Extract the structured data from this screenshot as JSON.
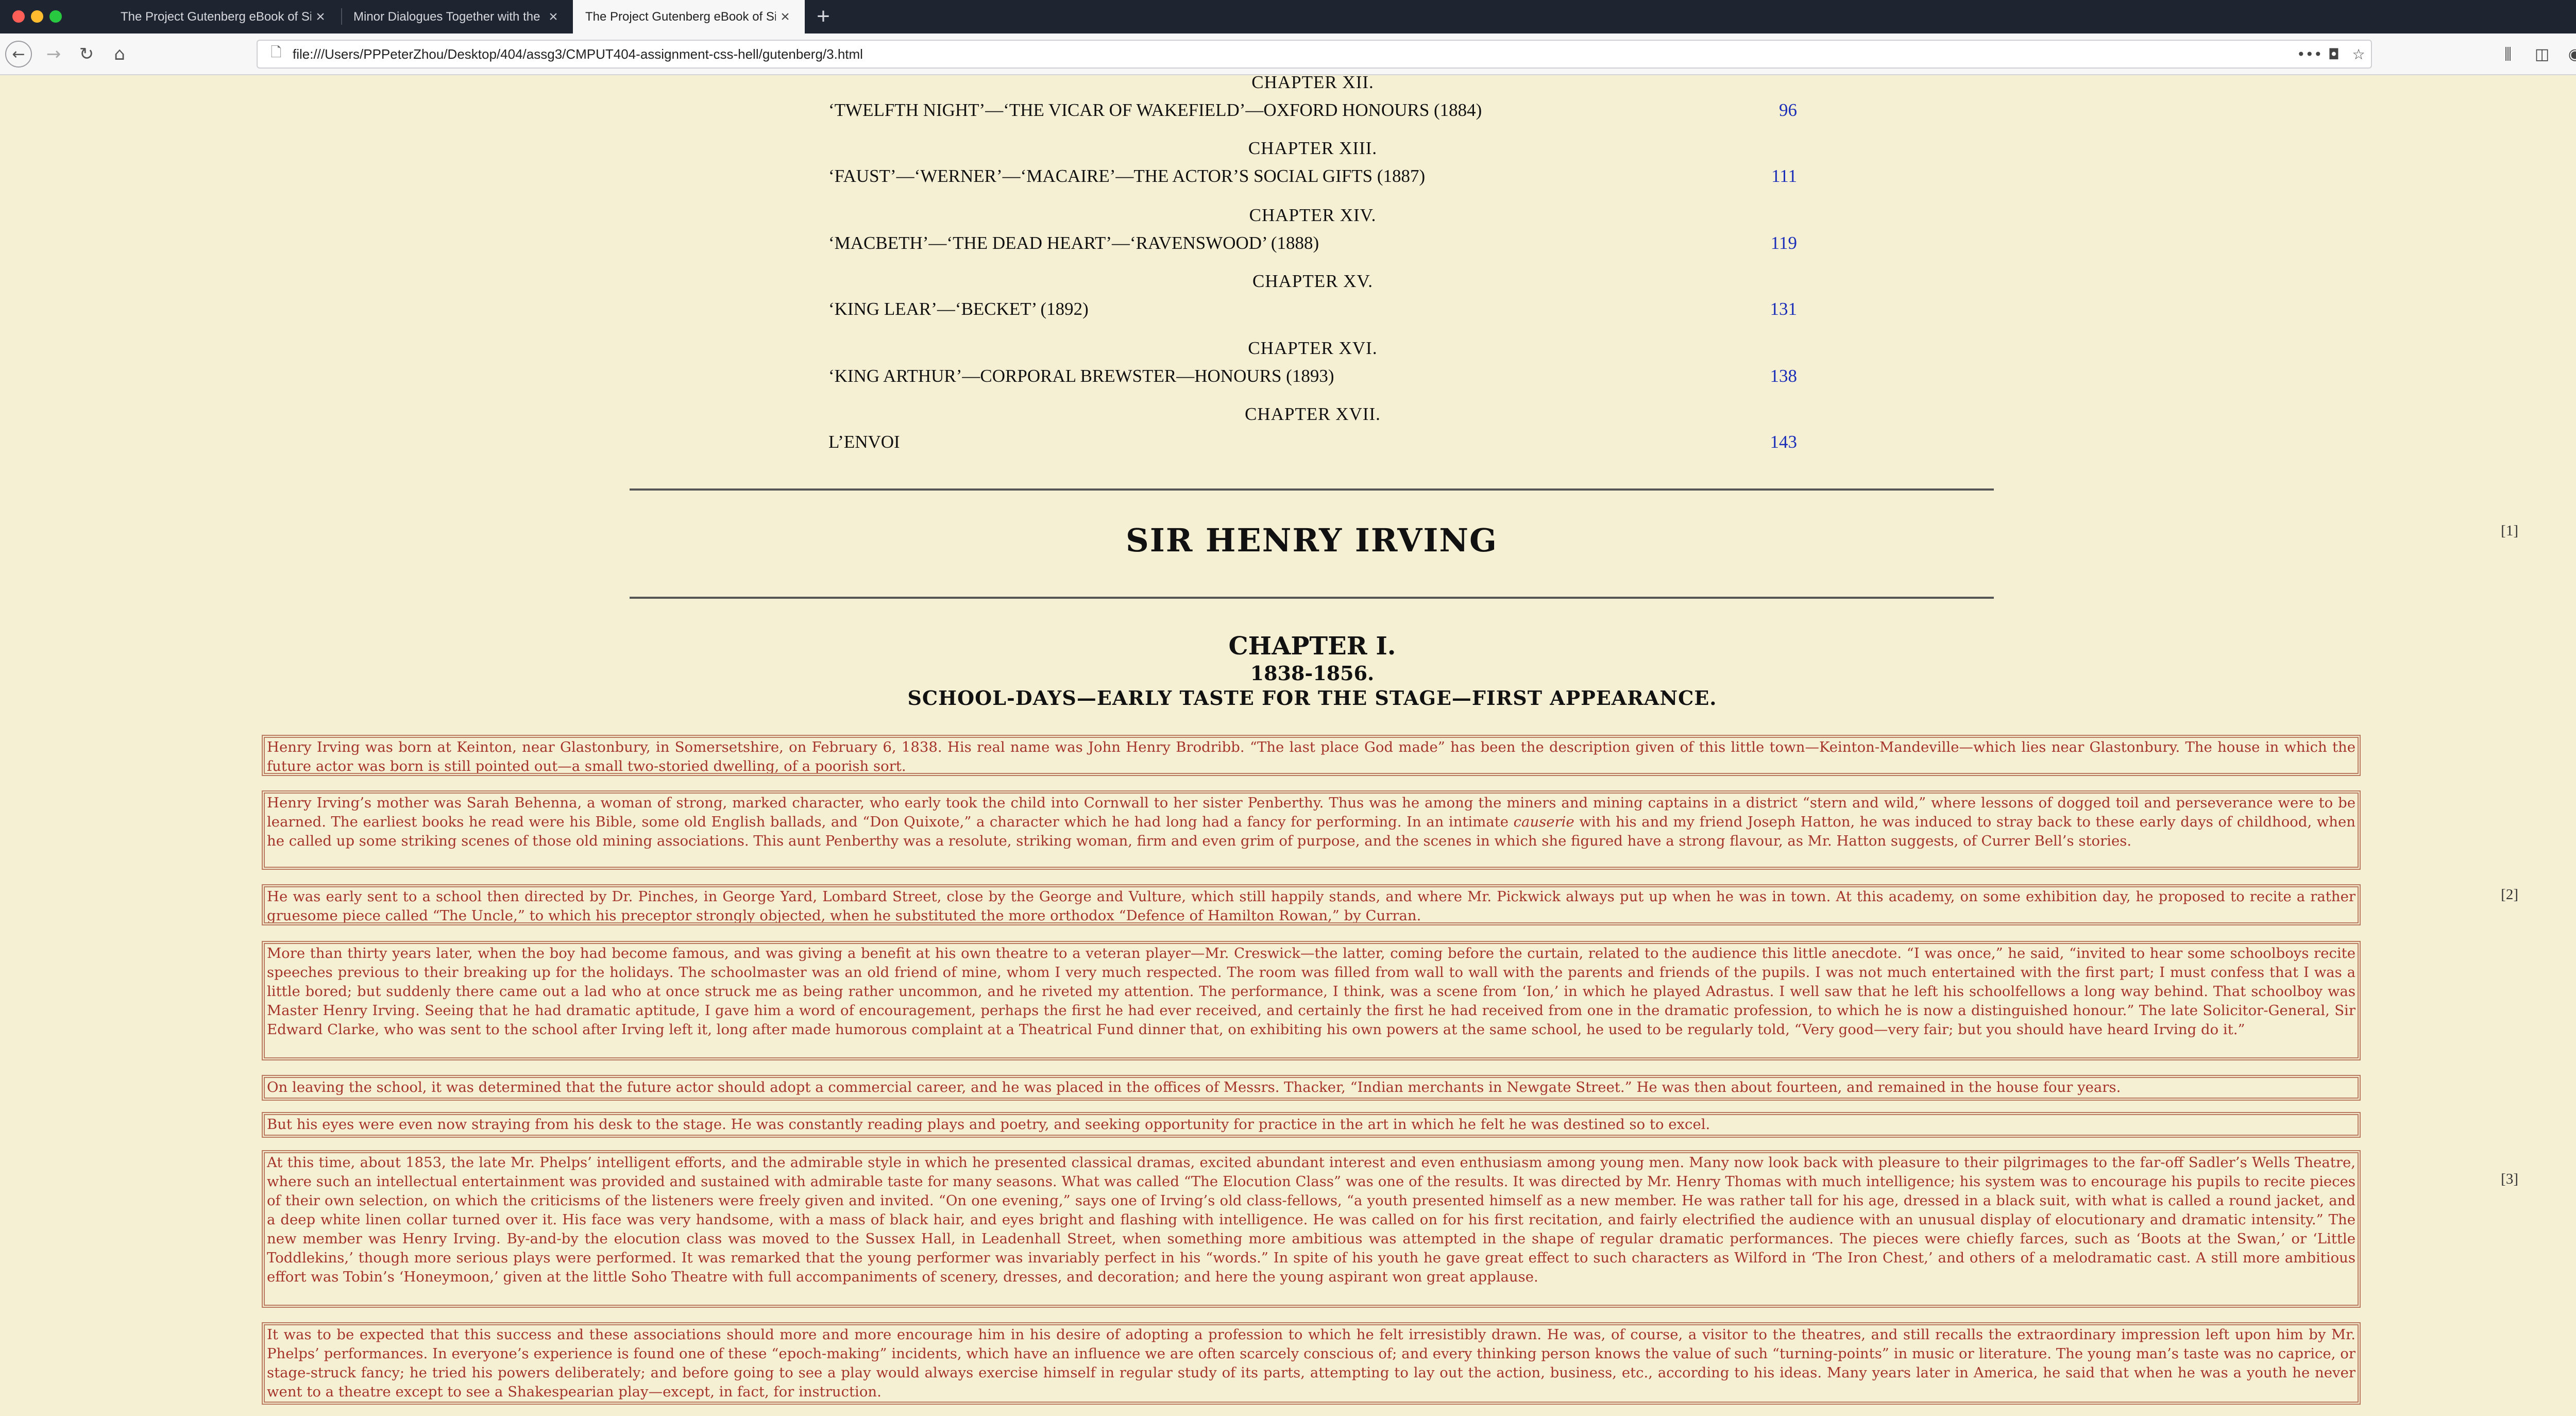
{
  "browser": {
    "tabs": [
      {
        "title": "The Project Gutenberg eBook of Si",
        "active": false
      },
      {
        "title": "Minor Dialogues Together with the",
        "active": false
      },
      {
        "title": "The Project Gutenberg eBook of Si",
        "active": true
      }
    ],
    "url": "file:///Users/PPPeterZhou/Desktop/404/assg3/CMPUT404-assignment-css-hell/gutenberg/3.html",
    "page_action_glyph": "•••"
  },
  "toc": [
    {
      "chapter": "CHAPTER XII.",
      "title": "‘TWELFTH NIGHT’—‘THE VICAR OF WAKEFIELD’—OXFORD HONOURS (1884)",
      "page": "96"
    },
    {
      "chapter": "CHAPTER XIII.",
      "title": "‘FAUST’—‘WERNER’—‘MACAIRE’—THE ACTOR’S SOCIAL GIFTS (1887)",
      "page": "111"
    },
    {
      "chapter": "CHAPTER XIV.",
      "title": "‘MACBETH’—‘THE DEAD HEART’—‘RAVENSWOOD’ (1888)",
      "page": "119"
    },
    {
      "chapter": "CHAPTER XV.",
      "title": "‘KING LEAR’—‘BECKET’ (1892)",
      "page": "131"
    },
    {
      "chapter": "CHAPTER XVI.",
      "title": "‘KING ARTHUR’—CORPORAL BREWSTER—HONOURS (1893)",
      "page": "138"
    },
    {
      "chapter": "CHAPTER XVII.",
      "title": "L’ENVOI",
      "page": "143"
    }
  ],
  "book_title": "SIR HENRY IRVING",
  "page_markers": [
    "[1]",
    "[2]",
    "[3]"
  ],
  "chapter": {
    "title": "CHAPTER I.",
    "years": "1838-1856.",
    "subtitle": "SCHOOL-DAYS—EARLY TASTE FOR THE STAGE—FIRST APPEARANCE."
  },
  "paragraphs": [
    {
      "text": "Henry Irving was born at Keinton, near Glastonbury, in Somersetshire, on February 6, 1838. His real name was John Henry Brodribb. “The last place God made” has been the description given of this little town—Keinton-Mandeville—which lies near Glastonbury. The house in which the future actor was born is still pointed out—a small two-storied dwelling, of a poorish sort."
    },
    {
      "text_before": "Henry Irving’s mother was Sarah Behenna, a woman of strong, marked character, who early took the child into Cornwall to her sister Penberthy. Thus was he among the miners and mining captains in a district “stern and wild,” where lessons of dogged toil and perseverance were to be learned. The earliest books he read were his Bible, some old English ballads, and “Don Quixote,” a character which he had long had a fancy for performing. In an intimate ",
      "emphasis": "causerie",
      "text_after": " with his and my friend Joseph Hatton, he was induced to stray back to these early days of childhood, when he called up some striking scenes of those old mining associations. This aunt Penberthy was a resolute, striking woman, firm and even grim of purpose, and the scenes in which she figured have a strong flavour, as Mr. Hatton suggests, of Currer Bell’s stories."
    },
    {
      "text": "He was early sent to a school then directed by Dr. Pinches, in George Yard, Lombard Street, close by the George and Vulture, which still happily stands, and where Mr. Pickwick always put up when he was in town. At this academy, on some exhibition day, he proposed to recite a rather gruesome piece called “The Uncle,” to which his preceptor strongly objected, when he substituted the more orthodox “Defence of Hamilton Rowan,” by Curran."
    },
    {
      "text": "More than thirty years later, when the boy had become famous, and was giving a benefit at his own theatre to a veteran player—Mr. Creswick—the latter, coming before the curtain, related to the audience this little anecdote. “I was once,” he said, “invited to hear some schoolboys recite speeches previous to their breaking up for the holidays. The schoolmaster was an old friend of mine, whom I very much respected. The room was filled from wall to wall with the parents and friends of the pupils. I was not much entertained with the first part; I must confess that I was a little bored; but suddenly there came out a lad who at once struck me as being rather uncommon, and he riveted my attention. The performance, I think, was a scene from ‘Ion,’ in which he played Adrastus. I well saw that he left his schoolfellows a long way behind. That schoolboy was Master Henry Irving. Seeing that he had dramatic aptitude, I gave him a word of encouragement, perhaps the first he had ever received, and certainly the first he had received from one in the dramatic profession, to which he is now a distinguished honour.” The late Solicitor-General, Sir Edward Clarke, who was sent to the school after Irving left it, long after made humorous complaint at a Theatrical Fund dinner that, on exhibiting his own powers at the same school, he used to be regularly told, “Very good—very fair; but you should have heard Irving do it.”"
    },
    {
      "text": "On leaving the school, it was determined that the future actor should adopt a commercial career, and he was placed in the offices of Messrs. Thacker, “Indian merchants in Newgate Street.” He was then about fourteen, and remained in the house four years."
    },
    {
      "text": "But his eyes were even now straying from his desk to the stage. He was constantly reading plays and poetry, and seeking opportunity for practice in the art in which he felt he was destined so to excel."
    },
    {
      "text": "At this time, about 1853, the late Mr. Phelps’ intelligent efforts, and the admirable style in which he presented classical dramas, excited abundant interest and even enthusiasm among young men. Many now look back with pleasure to their pilgrimages to the far-off Sadler’s Wells Theatre, where such an intellectual entertainment was provided and sustained with admirable taste for many seasons. What was called “The Elocution Class” was one of the results. It was directed by Mr. Henry Thomas with much intelligence; his system was to encourage his pupils to recite pieces of their own selection, on which the criticisms of the listeners were freely given and invited. “On one evening,” says one of Irving’s old class-fellows, “a youth presented himself as a new member. He was rather tall for his age, dressed in a black suit, with what is called a round jacket, and a deep white linen collar turned over it. His face was very handsome, with a mass of black hair, and eyes bright and flashing with intelligence. He was called on for his first recitation, and fairly electrified the audience with an unusual display of elocutionary and dramatic intensity.” The new member was Henry Irving. By-and-by the elocution class was moved to the Sussex Hall, in Leadenhall Street, when something more ambitious was attempted in the shape of regular dramatic performances. The pieces were chiefly farces, such as ‘Boots at the Swan,’ or ‘Little Toddlekins,’ though more serious plays were performed. It was remarked that the young performer was invariably perfect in his “words.” In spite of his youth he gave great effect to such characters as Wilford in ‘The Iron Chest,’ and others of a melodramatic cast. A still more ambitious effort was Tobin’s ‘Honeymoon,’ given at the little Soho Theatre with full accompaniments of scenery, dresses, and decoration; and here the young aspirant won great applause."
    },
    {
      "text": "It was to be expected that this success and these associations should more and more encourage him in his desire of adopting a profession to which he felt irresistibly drawn. He was, of course, a visitor to the theatres, and still recalls the extraordinary impression left upon him by Mr. Phelps’ performances. In everyone’s experience is found one of these “epoch-making” incidents, which have an influence we are often scarcely conscious of; and every thinking person knows the value of such “turning-points” in music or literature. The young man’s taste was no caprice, or stage-struck fancy; he tried his powers deliberately; and before going to see a play would always exercise himself in regular study of its parts, attempting to lay out the action, business, etc., according to his ideas. Many years later in America, he said that when he was a youth he never went to a theatre except to see a Shakespearian play—except, in fact, for instruction."
    }
  ]
}
